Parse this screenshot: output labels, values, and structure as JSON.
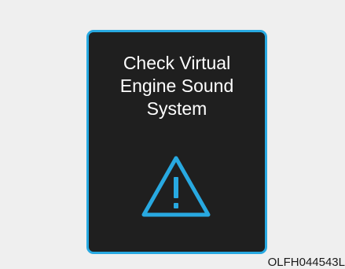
{
  "display": {
    "message_lines": [
      "Check Virtual",
      "Engine Sound",
      "System"
    ],
    "icon": "warning-triangle-icon",
    "colors": {
      "background": "#1f1f1f",
      "accent": "#28a9e1",
      "text": "#ffffff"
    }
  },
  "image_code": "OLFH044543L"
}
